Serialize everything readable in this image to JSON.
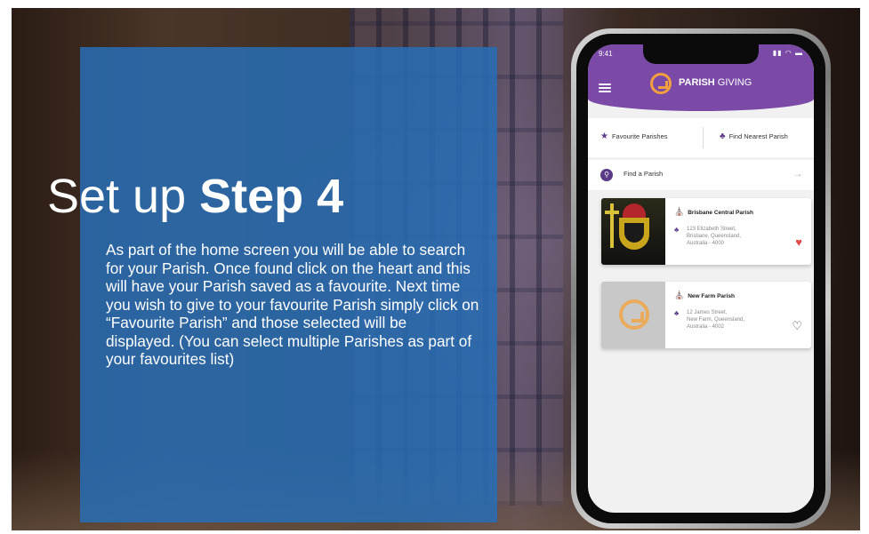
{
  "slide": {
    "title_prefix": "Set up",
    "title_bold": "Step 4",
    "body": "As part of the home screen you will be able to search for your Parish. Once found click on the heart and this will have your Parish saved as a favourite. Next time you wish to give to your favourite Parish simply click on “Favourite Parish” and those selected will be displayed. (You can select multiple Parishes as part of your favourites list)"
  },
  "phone": {
    "time": "9:41",
    "status_icons": "signal-wifi-battery",
    "brand_bold": "PARISH",
    "brand_light": " GIVING",
    "tabs": [
      {
        "label": "Favourite Parishes",
        "icon": "star-icon"
      },
      {
        "label": "Find Nearest Parish",
        "icon": "people-icon"
      }
    ],
    "search": {
      "label": "Find a Parish",
      "icon": "search-icon"
    },
    "parishes": [
      {
        "name": "Brisbane Central Parish",
        "address_lines": [
          "123 Elizabeth Street,",
          "Brisbane, Queensland,",
          "Australia - 4000"
        ],
        "favourite": true
      },
      {
        "name": "New Farm Parish",
        "address_lines": [
          "12 James Street,",
          "New Farm, Queensland,",
          "Australia - 4002"
        ],
        "favourite": false
      }
    ]
  },
  "colors": {
    "panel_blue": "#286EB4",
    "header_purple": "#7A4AA6",
    "accent_orange": "#F2A03D",
    "heart_red": "#E04A4A"
  }
}
